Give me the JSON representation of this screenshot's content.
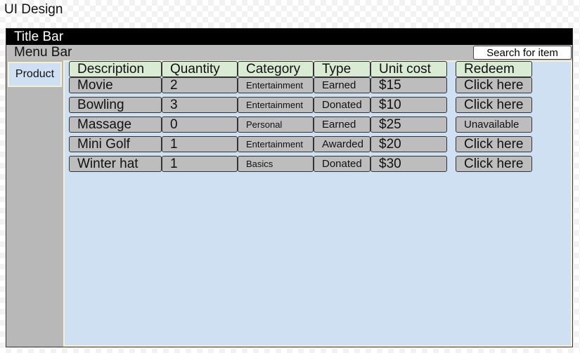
{
  "page": {
    "title": "UI Design"
  },
  "window": {
    "title_bar": "Title Bar",
    "menu_bar": "Menu Bar",
    "search_placeholder": "Search for item"
  },
  "sidebar": {
    "items": [
      {
        "label": "Product"
      }
    ]
  },
  "table": {
    "headers": [
      "Description",
      "Quantity",
      "Category",
      "Type",
      "Unit cost",
      "Redeem"
    ],
    "rows": [
      [
        "Movie",
        "2",
        "Entertainment",
        "Earned",
        "$15",
        "Click here"
      ],
      [
        "Bowling",
        "3",
        "Entertainment",
        "Donated",
        "$10",
        "Click here"
      ],
      [
        "Massage",
        "0",
        "Personal",
        "Earned",
        "$25",
        "Unavailable"
      ],
      [
        "Mini Golf",
        "1",
        "Entertainment",
        "Awarded",
        "$20",
        "Click here"
      ],
      [
        "Winter hat",
        "1",
        "Basics",
        "Donated",
        "$30",
        "Click here"
      ]
    ]
  }
}
